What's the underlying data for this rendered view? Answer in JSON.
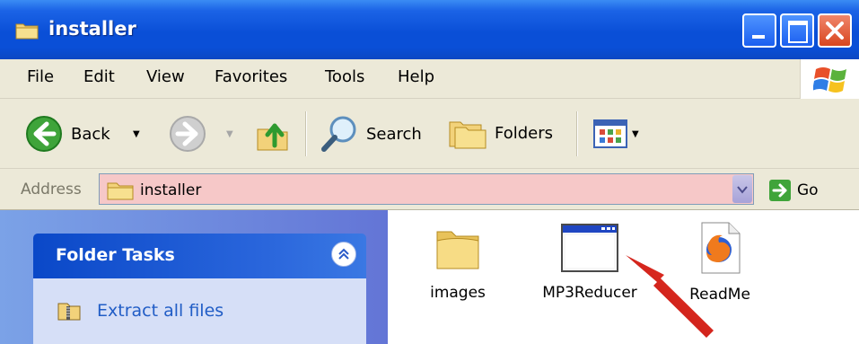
{
  "window": {
    "title": "installer",
    "controls": {
      "minimize": "minimize",
      "maximize": "maximize",
      "close": "close"
    }
  },
  "menu": [
    "File",
    "Edit",
    "View",
    "Favorites",
    "Tools",
    "Help"
  ],
  "toolbar": {
    "back_label": "Back",
    "search_label": "Search",
    "folders_label": "Folders"
  },
  "address": {
    "label": "Address",
    "value": "installer",
    "go_label": "Go"
  },
  "folder_tasks": {
    "title": "Folder Tasks",
    "items": [
      {
        "label": "Extract all files"
      }
    ]
  },
  "files": [
    {
      "name": "images",
      "icon": "folder-icon"
    },
    {
      "name": "MP3Reducer",
      "icon": "application-window-icon"
    },
    {
      "name": "ReadMe",
      "icon": "firefox-document-icon"
    }
  ],
  "colors": {
    "titlebar": "#0a4fd7",
    "address_highlight": "#f6c8c8",
    "task_link": "#215dc6",
    "annotation_arrow": "#e21b1b"
  }
}
